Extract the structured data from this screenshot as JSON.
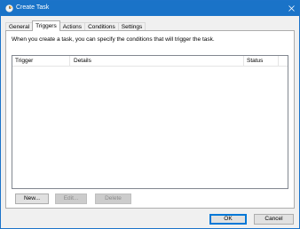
{
  "window": {
    "title": "Create Task",
    "icon": "task-scheduler-icon",
    "close_icon": "close-icon",
    "accent": "#1a73c8"
  },
  "tabs": [
    {
      "label": "General",
      "active": false
    },
    {
      "label": "Triggers",
      "active": true
    },
    {
      "label": "Actions",
      "active": false
    },
    {
      "label": "Conditions",
      "active": false
    },
    {
      "label": "Settings",
      "active": false
    }
  ],
  "triggers": {
    "description": "When you create a task, you can specify the conditions that will trigger the task.",
    "columns": [
      "Trigger",
      "Details",
      "Status"
    ],
    "rows": [],
    "buttons": {
      "new": "New...",
      "edit": "Edit...",
      "delete": "Delete"
    }
  },
  "footer": {
    "ok": "OK",
    "cancel": "Cancel"
  }
}
